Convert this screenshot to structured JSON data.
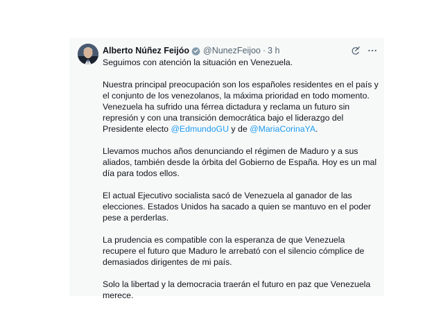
{
  "author": {
    "name": "Alberto Núñez Feijóo",
    "handle": "@NunezFeijoo",
    "separator": "·",
    "time": "3 h"
  },
  "icons": {
    "verified": "verified-badge-icon",
    "grok": "grok-icon",
    "more": "more-icon"
  },
  "colors": {
    "mention": "#1d9bf0",
    "verified": "#829aab",
    "muted": "#536471",
    "card_bg": "#f7f9f9"
  },
  "tweet": {
    "p1": "Seguimos con atención la situación en Venezuela.",
    "p2a": "Nuestra principal preocupación son los españoles residentes en el país y el conjunto de los venezolanos, la máxima prioridad en todo momento. Venezuela ha sufrido una férrea dictadura y reclama un futuro sin represión y con una transición democrática bajo el liderazgo del Presidente electo ",
    "mention1": "@EdmundoGU",
    "p2b": " y de ",
    "mention2": "@MariaCorinaYA",
    "p2c": ".",
    "p3": "Llevamos muchos años denunciando el régimen de Maduro y a sus aliados, también desde la órbita del Gobierno de España. Hoy es un mal día para todos ellos.",
    "p4": "El actual Ejecutivo socialista sacó de Venezuela al ganador de las elecciones. Estados Unidos ha sacado a quien se mantuvo en el poder pese a perderlas.",
    "p5": "La prudencia es compatible con la esperanza de que Venezuela recupere el futuro que Maduro le arrebató con el silencio cómplice de demasiados dirigentes de mi país.",
    "p6": "Solo la libertad y la democracia traerán el futuro en paz que Venezuela merece."
  }
}
